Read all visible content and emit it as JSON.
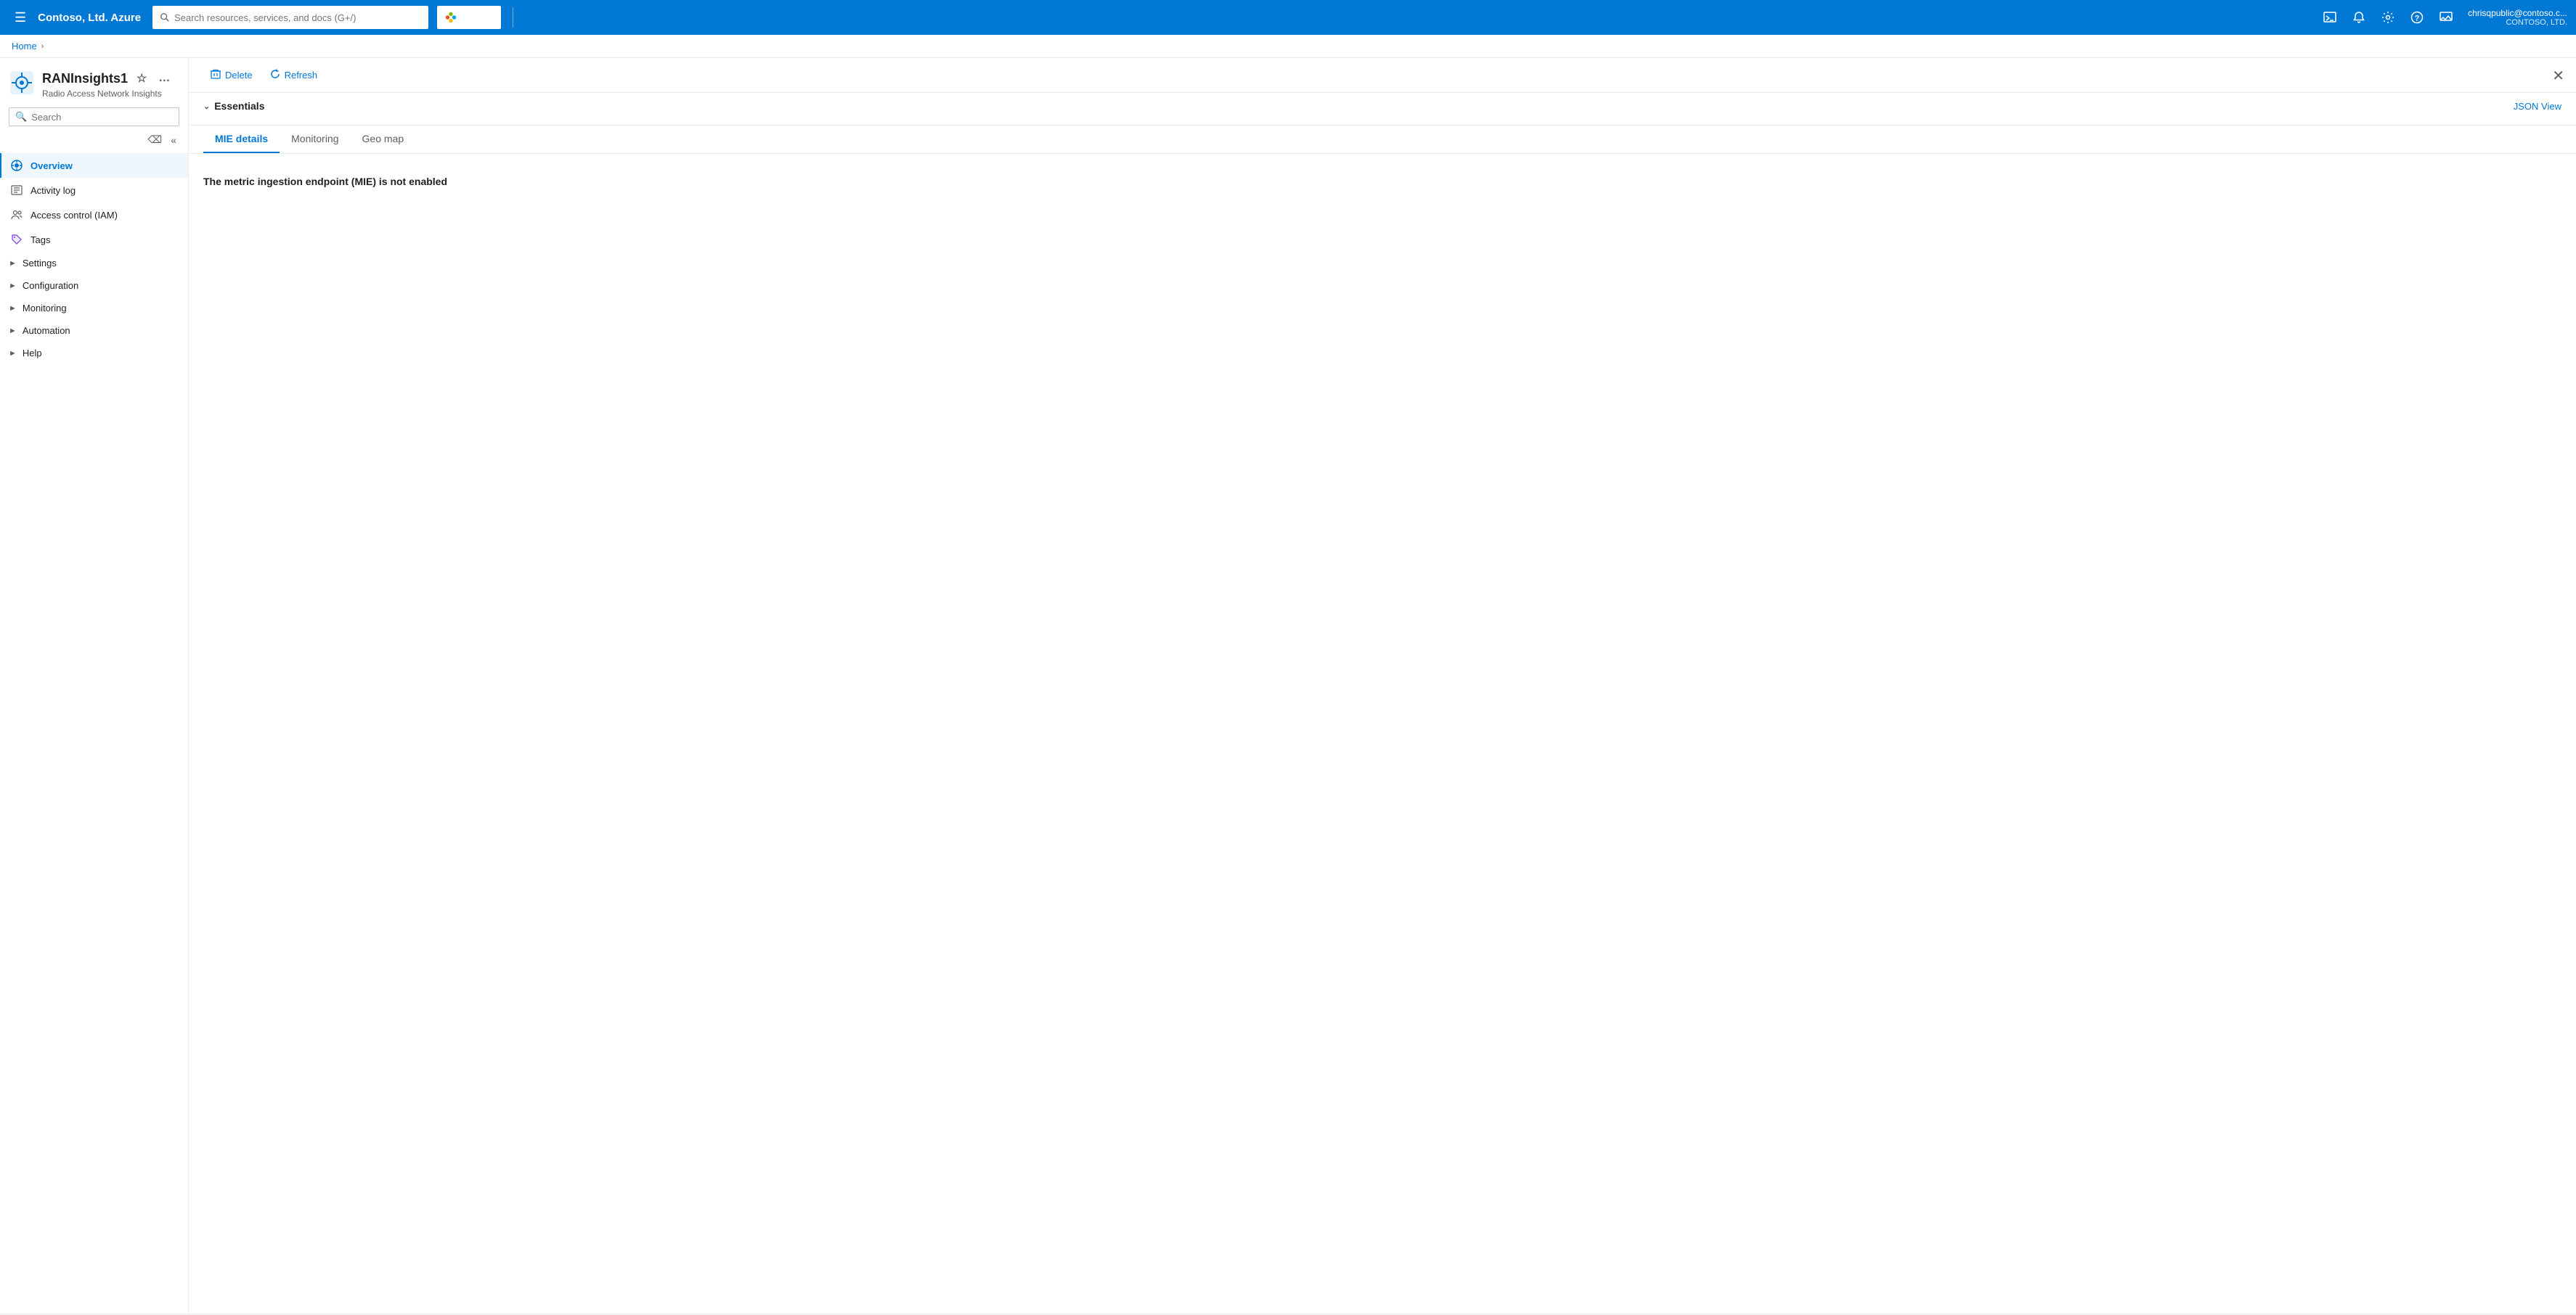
{
  "topnav": {
    "brand": "Contoso, Ltd. Azure",
    "search_placeholder": "Search resources, services, and docs (G+/)",
    "copilot_label": "Copilot",
    "user_email": "chrisqpublic@contoso.c...",
    "user_org": "CONTOSO, LTD.",
    "icons": [
      "terminal",
      "bell",
      "settings",
      "help",
      "feedback"
    ]
  },
  "breadcrumb": {
    "home": "Home",
    "separator": "›"
  },
  "sidebar": {
    "resource_name": "RANInsights1",
    "resource_subtitle": "Radio Access Network Insights",
    "search_placeholder": "Search",
    "nav_items": [
      {
        "label": "Overview",
        "active": true,
        "icon": "network",
        "expandable": false
      },
      {
        "label": "Activity log",
        "active": false,
        "icon": "list",
        "expandable": false
      },
      {
        "label": "Access control (IAM)",
        "active": false,
        "icon": "people",
        "expandable": false
      },
      {
        "label": "Tags",
        "active": false,
        "icon": "tag",
        "expandable": false
      },
      {
        "label": "Settings",
        "active": false,
        "icon": null,
        "expandable": true
      },
      {
        "label": "Configuration",
        "active": false,
        "icon": null,
        "expandable": true
      },
      {
        "label": "Monitoring",
        "active": false,
        "icon": null,
        "expandable": true
      },
      {
        "label": "Automation",
        "active": false,
        "icon": null,
        "expandable": true
      },
      {
        "label": "Help",
        "active": false,
        "icon": null,
        "expandable": true
      }
    ]
  },
  "toolbar": {
    "delete_label": "Delete",
    "refresh_label": "Refresh"
  },
  "essentials": {
    "title": "Essentials",
    "json_view_label": "JSON View"
  },
  "tabs": [
    {
      "label": "MIE details",
      "active": true
    },
    {
      "label": "Monitoring",
      "active": false
    },
    {
      "label": "Geo map",
      "active": false
    }
  ],
  "main": {
    "mie_message": "The metric ingestion endpoint (MIE) is not enabled"
  }
}
